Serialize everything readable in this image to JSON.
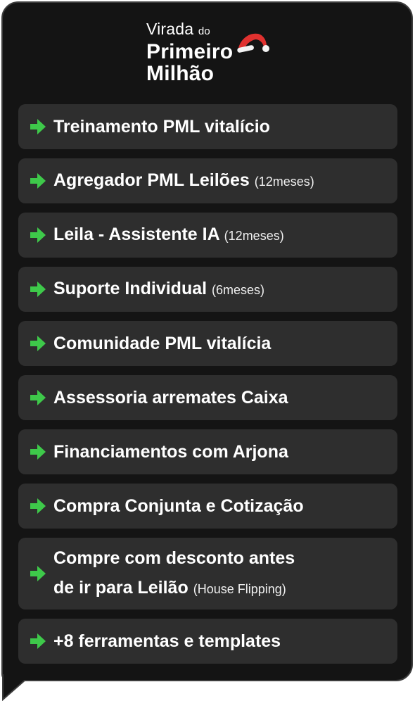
{
  "logo": {
    "line1_main": "Virada",
    "line1_small": "do",
    "line2": "Primeiro",
    "line3": "Milhão"
  },
  "colors": {
    "arrow": "#3ec94a",
    "card_bg": "#141414",
    "item_bg": "#2e2e2e",
    "hat_red": "#e0312f"
  },
  "items": [
    {
      "label": "Treinamento PML vitalício",
      "sub": ""
    },
    {
      "label": "Agregador PML Leilões",
      "sub": "(12meses)"
    },
    {
      "label": "Leila - Assistente IA",
      "sub": "(12meses)"
    },
    {
      "label": "Suporte Individual",
      "sub": "(6meses)"
    },
    {
      "label": "Comunidade PML vitalícia",
      "sub": ""
    },
    {
      "label": "Assessoria arremates Caixa",
      "sub": ""
    },
    {
      "label": "Financiamentos com Arjona",
      "sub": ""
    },
    {
      "label": "Compra Conjunta e Cotização",
      "sub": ""
    },
    {
      "label": "Compre com desconto antes",
      "label2": "de ir para Leilão",
      "sub": "(House Flipping)"
    },
    {
      "label": "+8 ferramentas e templates",
      "sub": ""
    }
  ]
}
